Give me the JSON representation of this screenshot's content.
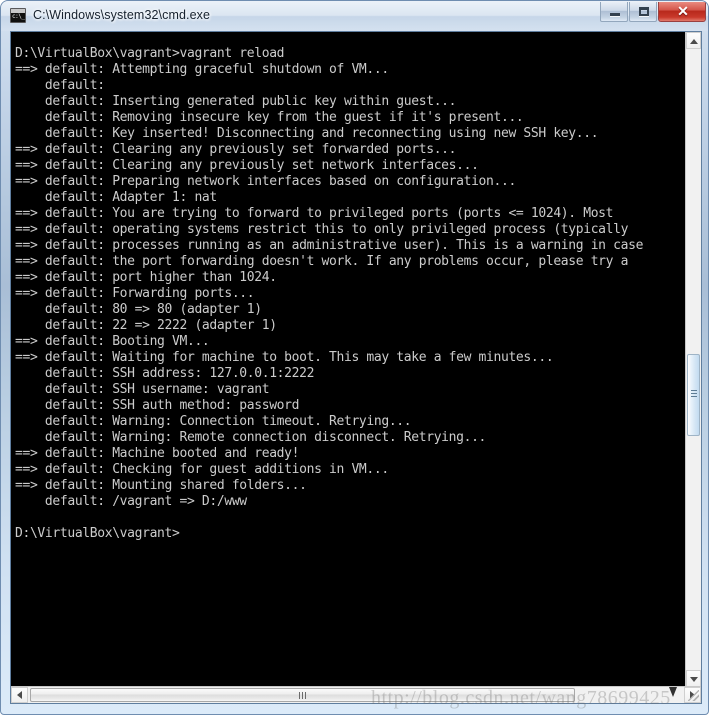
{
  "window": {
    "title": "C:\\Windows\\system32\\cmd.exe",
    "icon": "cmd-console-icon",
    "icon_text": "c:\\_",
    "buttons": {
      "minimize_label": "–",
      "maximize_label": "□",
      "close_label": "✕"
    },
    "colors": {
      "frame_top": "#d5e2f0",
      "frame_mid": "#a9bed6",
      "frame_bottom": "#dcebf9",
      "close_button": "#b8291c",
      "console_bg": "#000000",
      "console_fg": "#cccccc"
    }
  },
  "console": {
    "prompt_path": "D:\\VirtualBox\\vagrant>",
    "command": "vagrant reload",
    "lines": [
      "D:\\VirtualBox\\vagrant>vagrant reload",
      "==> default: Attempting graceful shutdown of VM...",
      "    default:",
      "    default: Inserting generated public key within guest...",
      "    default: Removing insecure key from the guest if it's present...",
      "    default: Key inserted! Disconnecting and reconnecting using new SSH key...",
      "==> default: Clearing any previously set forwarded ports...",
      "==> default: Clearing any previously set network interfaces...",
      "==> default: Preparing network interfaces based on configuration...",
      "    default: Adapter 1: nat",
      "==> default: You are trying to forward to privileged ports (ports <= 1024). Most",
      "==> default: operating systems restrict this to only privileged process (typically",
      "==> default: processes running as an administrative user). This is a warning in case",
      "==> default: the port forwarding doesn't work. If any problems occur, please try a",
      "==> default: port higher than 1024.",
      "==> default: Forwarding ports...",
      "    default: 80 => 80 (adapter 1)",
      "    default: 22 => 2222 (adapter 1)",
      "==> default: Booting VM...",
      "==> default: Waiting for machine to boot. This may take a few minutes...",
      "    default: SSH address: 127.0.0.1:2222",
      "    default: SSH username: vagrant",
      "    default: SSH auth method: password",
      "    default: Warning: Connection timeout. Retrying...",
      "    default: Warning: Remote connection disconnect. Retrying...",
      "==> default: Machine booted and ready!",
      "==> default: Checking for guest additions in VM...",
      "==> default: Mounting shared folders...",
      "    default: /vagrant => D:/www",
      "",
      "D:\\VirtualBox\\vagrant>"
    ]
  },
  "scrollbars": {
    "vertical": {
      "up_arrow": "▲",
      "down_arrow": "▼",
      "thumb_grip": "grip-lines"
    },
    "horizontal": {
      "left_arrow": "◀",
      "right_arrow": "▶",
      "thumb_grip": "grip-lines"
    }
  },
  "watermark": {
    "text": "http://blog.csdn.net/wang78699425"
  }
}
